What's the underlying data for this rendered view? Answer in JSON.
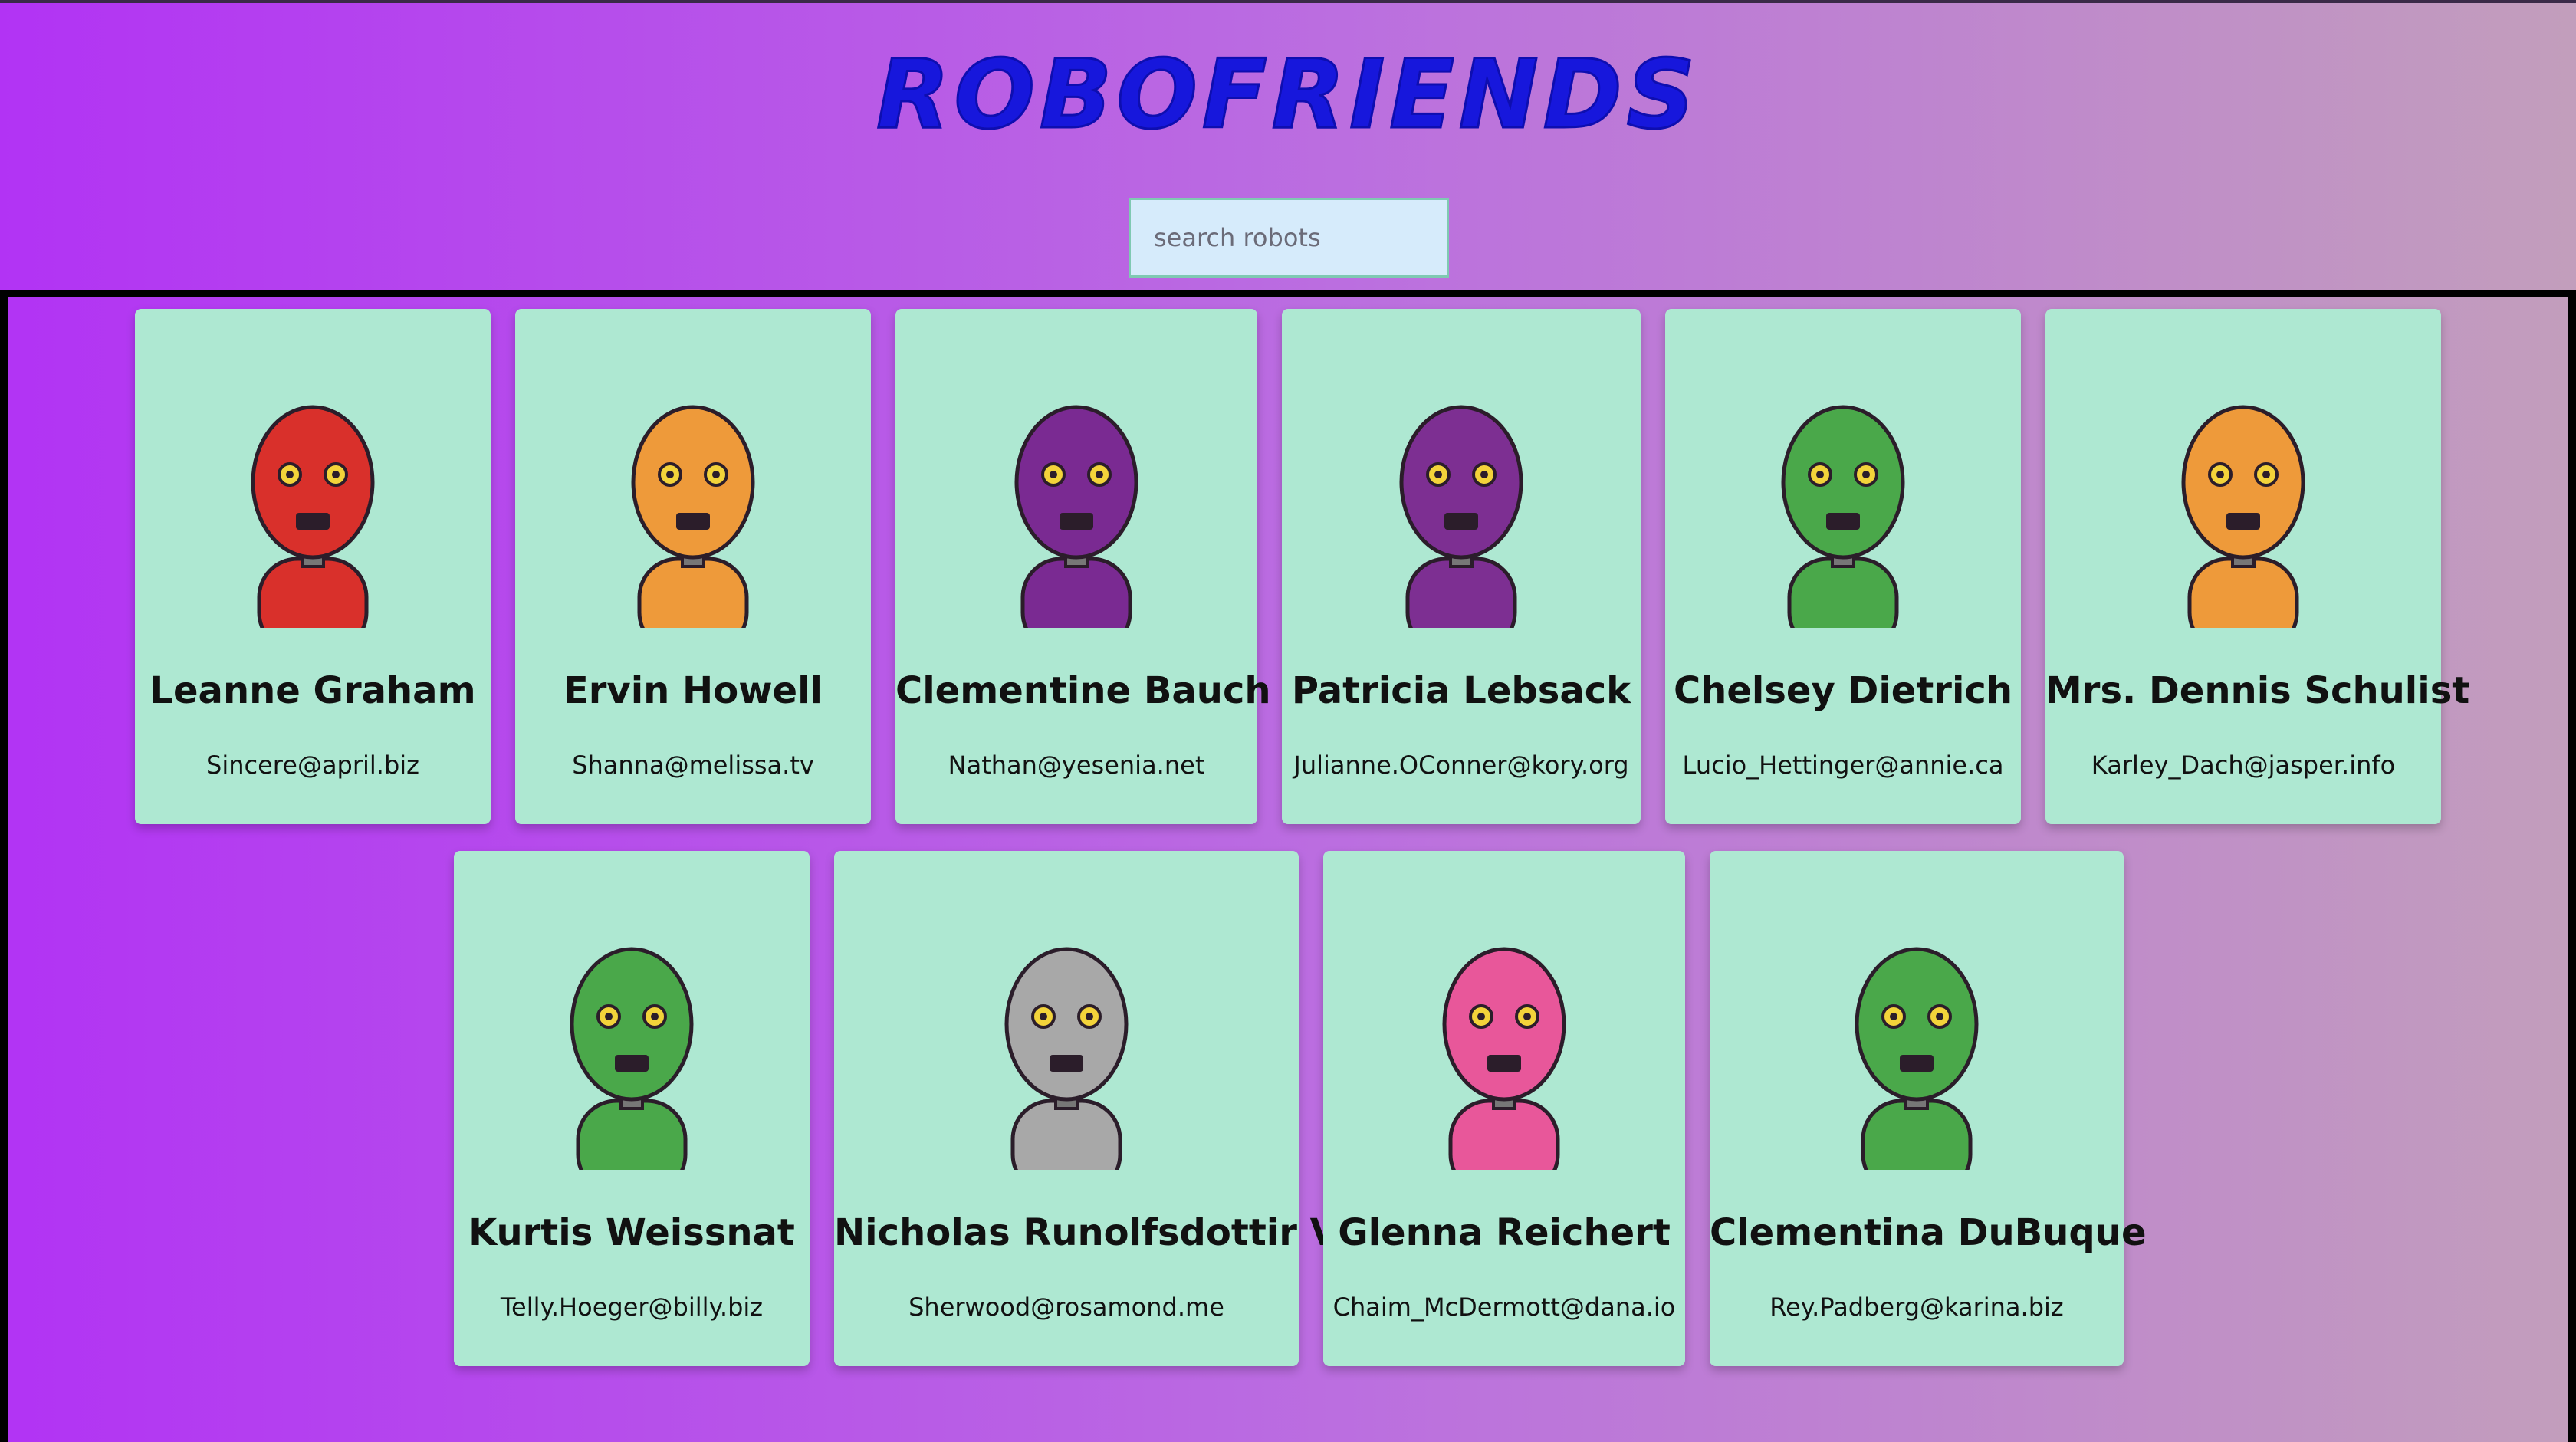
{
  "app": {
    "title": "ROBOFRIENDS"
  },
  "search": {
    "placeholder": "search robots",
    "value": ""
  },
  "robots": [
    {
      "name": "Leanne Graham",
      "email": "Sincere@april.biz",
      "color": "#d9302b"
    },
    {
      "name": "Ervin Howell",
      "email": "Shanna@melissa.tv",
      "color": "#ee9a3a"
    },
    {
      "name": "Clementine Bauch",
      "email": "Nathan@yesenia.net",
      "color": "#7a2a92"
    },
    {
      "name": "Patricia Lebsack",
      "email": "Julianne.OConner@kory.org",
      "color": "#7d2f92"
    },
    {
      "name": "Chelsey Dietrich",
      "email": "Lucio_Hettinger@annie.ca",
      "color": "#4aa84a"
    },
    {
      "name": "Mrs. Dennis Schulist",
      "email": "Karley_Dach@jasper.info",
      "color": "#ee9a3a"
    },
    {
      "name": "Kurtis Weissnat",
      "email": "Telly.Hoeger@billy.biz",
      "color": "#4aa84a"
    },
    {
      "name": "Nicholas Runolfsdottir V",
      "email": "Sherwood@rosamond.me",
      "color": "#a8a8a8"
    },
    {
      "name": "Glenna Reichert",
      "email": "Chaim_McDermott@dana.io",
      "color": "#e8579a"
    },
    {
      "name": "Clementina DuBuque",
      "email": "Rey.Padberg@karina.biz",
      "color": "#4aa84a"
    }
  ]
}
